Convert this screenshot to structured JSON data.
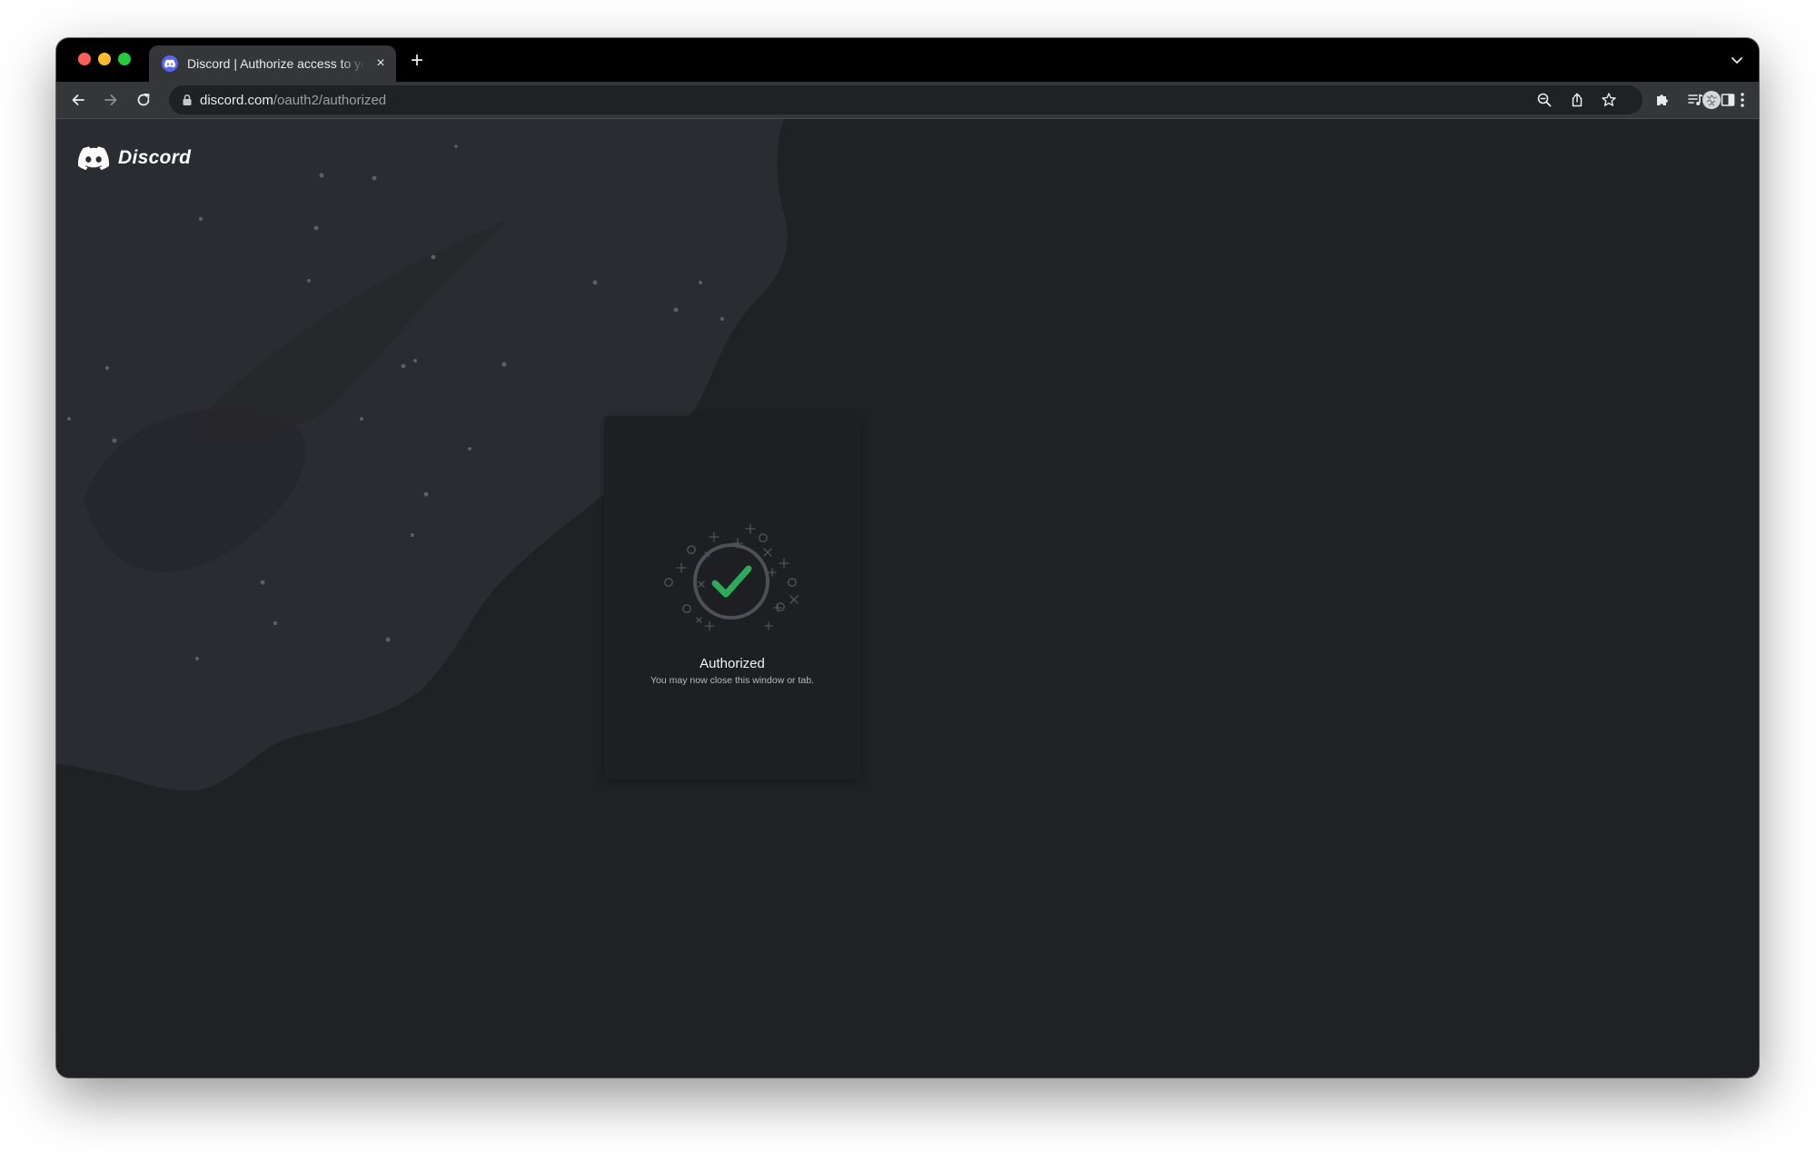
{
  "browser": {
    "tab": {
      "title": "Discord | Authorize access to your account",
      "close_glyph": "×",
      "favicon": "discord-icon"
    },
    "new_tab_glyph": "+",
    "address_bar": {
      "host": "discord.com",
      "path": "/oauth2/authorized"
    },
    "icons": [
      "back-arrow-icon",
      "forward-arrow-icon",
      "reload-icon",
      "lock-icon",
      "zoom-icon",
      "share-icon",
      "bookmark-star-icon",
      "extensions-puzzle-icon",
      "media-queue-icon",
      "side-panel-icon",
      "profile-avatar-icon",
      "kebab-menu-icon",
      "tab-search-chevron-icon"
    ]
  },
  "page": {
    "brand": {
      "name": "Discord",
      "logo": "discord-clyde-icon"
    },
    "card": {
      "title": "Authorized",
      "subtitle": "You may now close this window or tab.",
      "icon": "checkmark-icon"
    }
  },
  "colors": {
    "page_background": "#202125",
    "card_background": "#1e1f22",
    "success_green": "#2dab5a",
    "blurple": "#5865f2"
  }
}
